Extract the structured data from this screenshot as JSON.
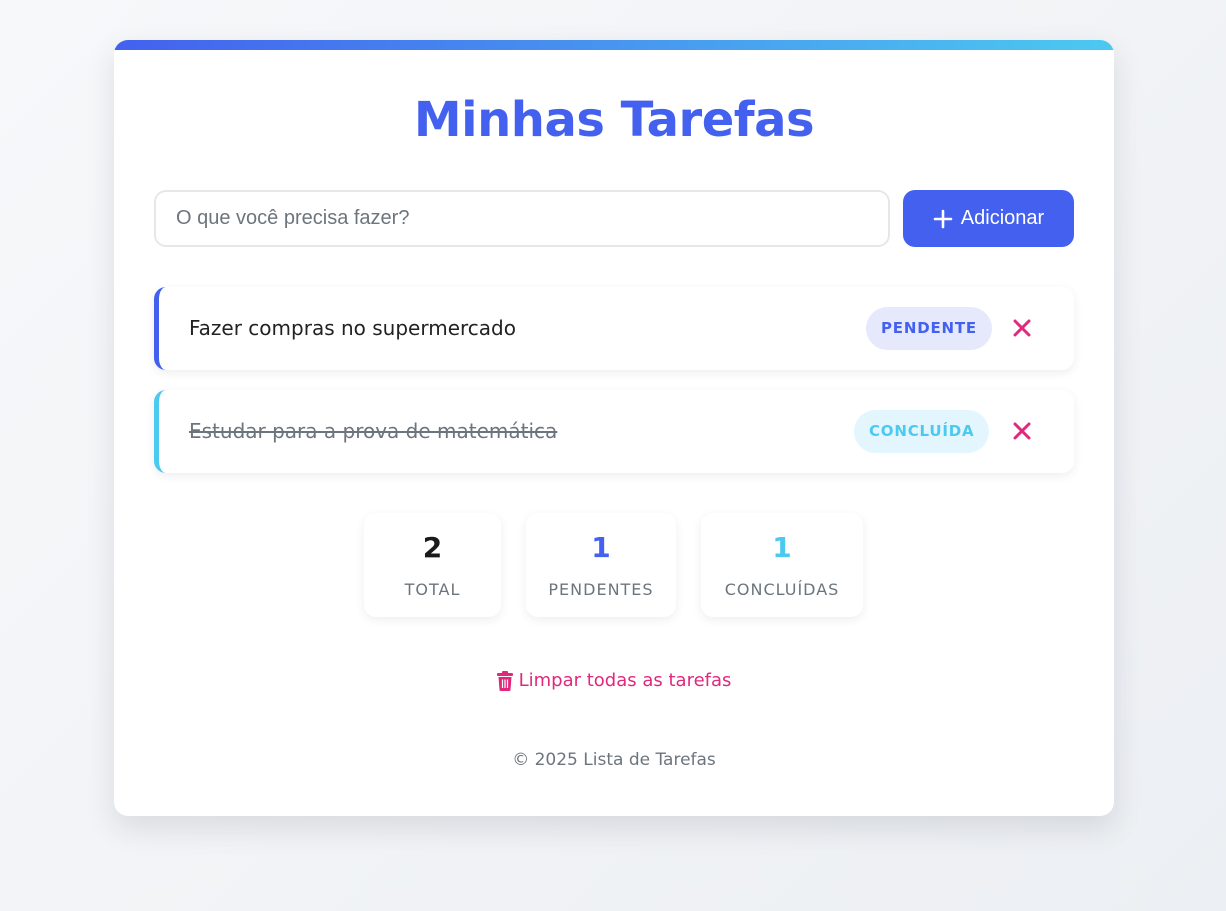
{
  "header": {
    "title": "Minhas Tarefas"
  },
  "input": {
    "placeholder": "O que você precisa fazer?",
    "value": ""
  },
  "add_button": {
    "label": "Adicionar",
    "icon": "plus-icon"
  },
  "tasks": [
    {
      "text": "Fazer compras no supermercado",
      "status": "PENDENTE",
      "completed": false,
      "delete_icon": "close-icon"
    },
    {
      "text": "Estudar para a prova de matemática",
      "status": "CONCLUÍDA",
      "completed": true,
      "delete_icon": "close-icon"
    }
  ],
  "stats": [
    {
      "value": "2",
      "label": "TOTAL"
    },
    {
      "value": "1",
      "label": "PENDENTES"
    },
    {
      "value": "1",
      "label": "CONCLUÍDAS"
    }
  ],
  "clear": {
    "label": "Limpar todas as tarefas",
    "icon": "trash-icon"
  },
  "footer": {
    "text": "© 2025 Lista de Tarefas"
  },
  "colors": {
    "primary": "#4361ee",
    "accent": "#4cc9f0",
    "danger": "#e0287d",
    "muted": "#6c757d"
  }
}
